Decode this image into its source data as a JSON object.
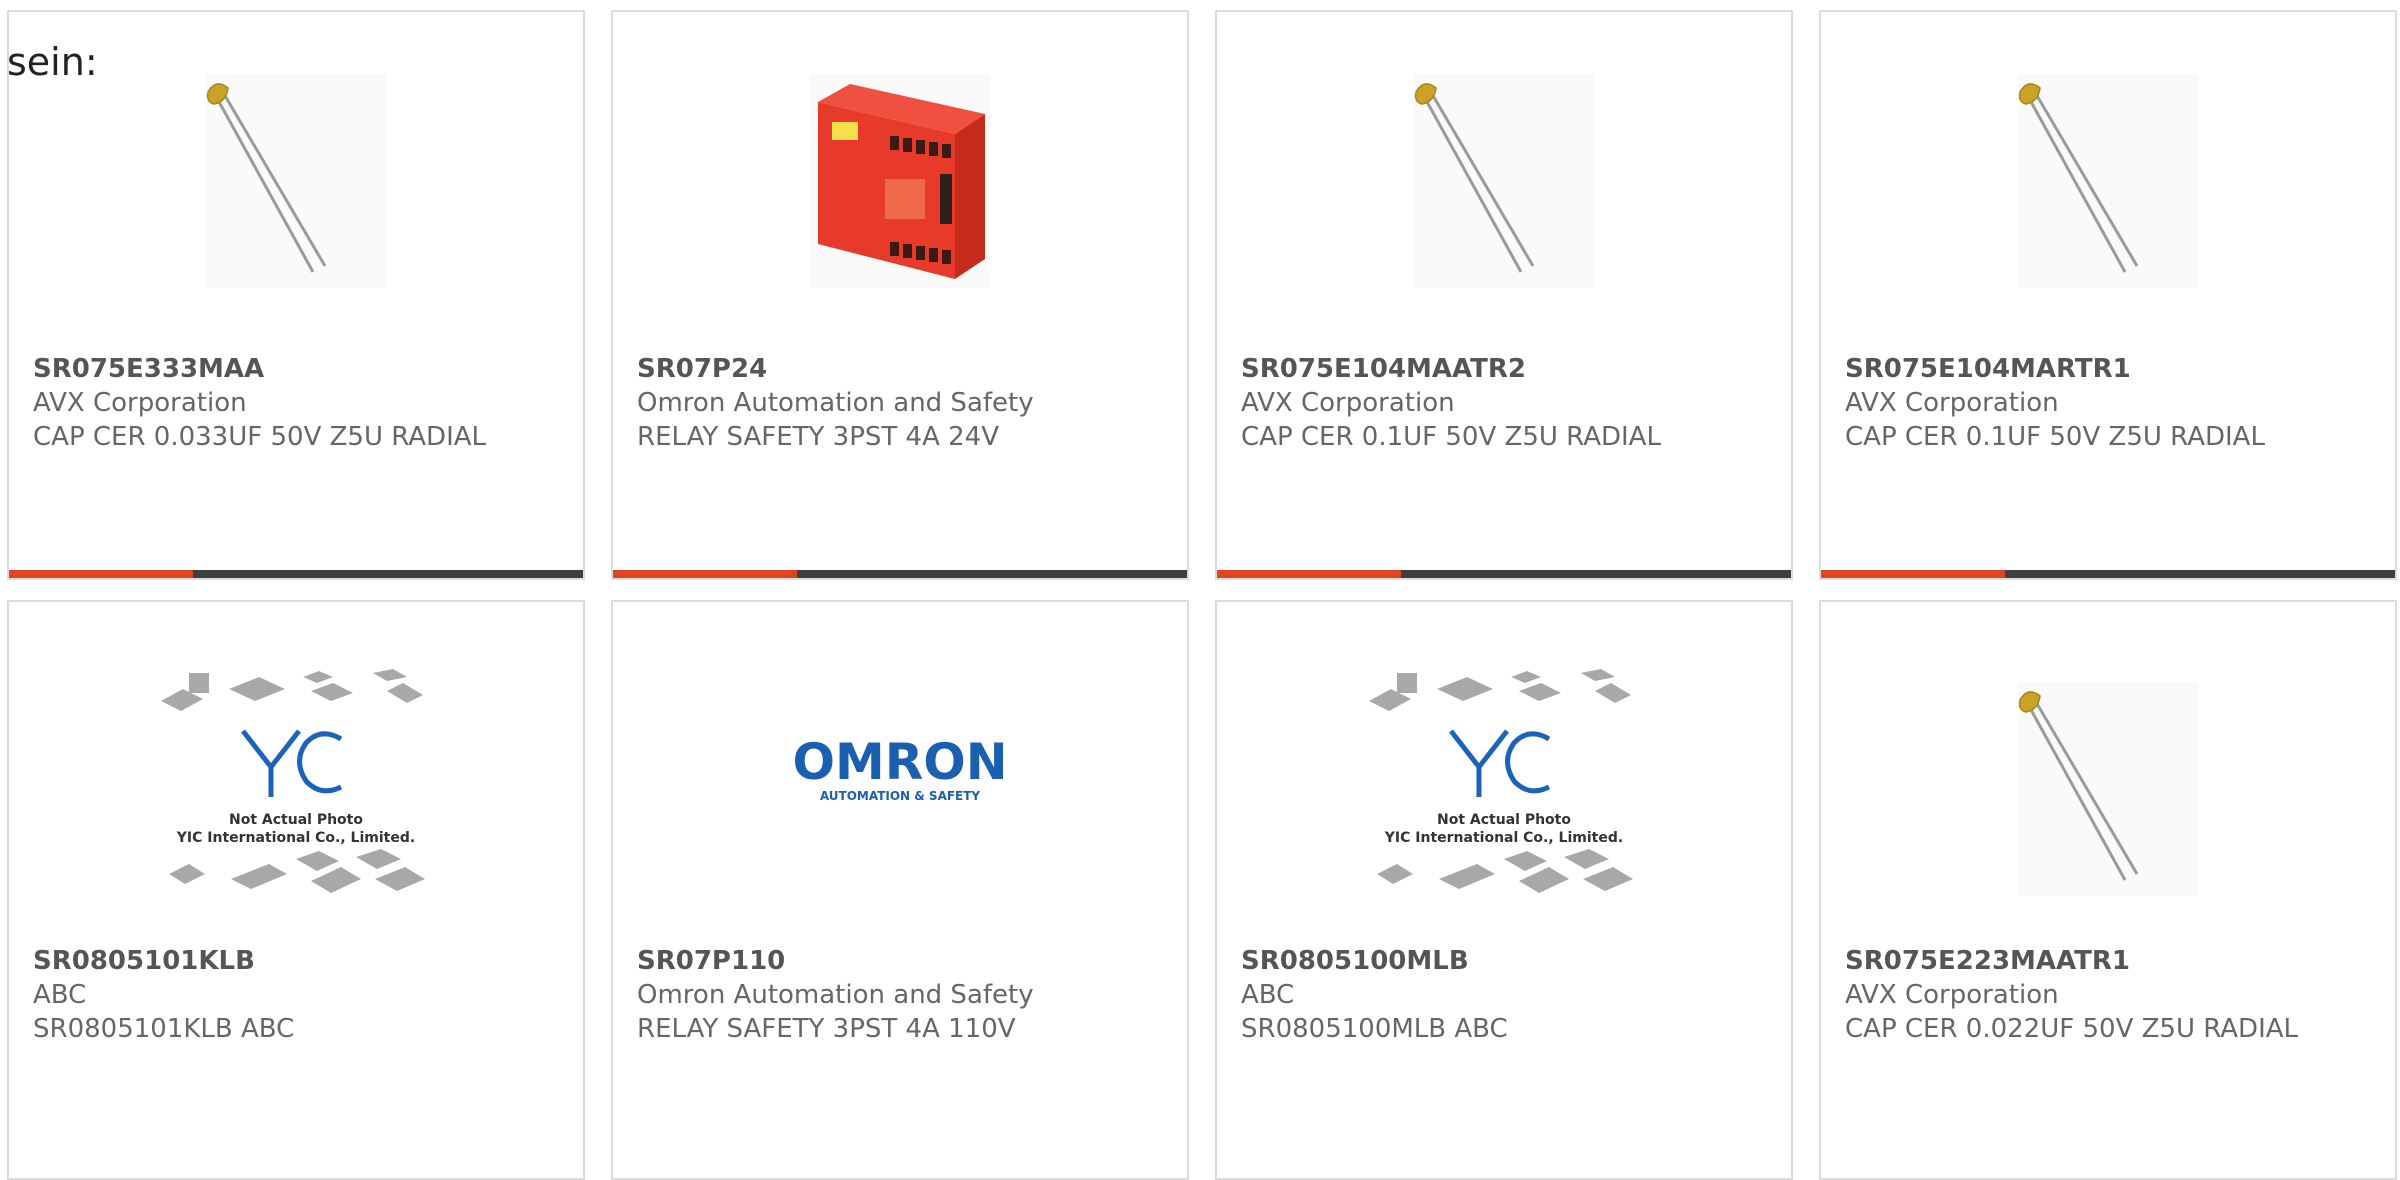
{
  "header": {
    "label": "sein:"
  },
  "colors": {
    "accent": "#e0451f",
    "bar_dark": "#3f3f3f",
    "capacitor_body": "#c9a227",
    "relay_red": "#e83a2a",
    "omron_blue": "#1b5fb0",
    "yic_blue": "#1a63b8"
  },
  "products": [
    {
      "part_number": "SR075E333MAA",
      "manufacturer": "AVX Corporation",
      "description": "CAP CER 0.033UF 50V Z5U RADIAL",
      "image": "capacitor-photo"
    },
    {
      "part_number": "SR07P24",
      "manufacturer": "Omron Automation and Safety",
      "description": "RELAY SAFETY 3PST 4A 24V",
      "image": "relay-photo"
    },
    {
      "part_number": "SR075E104MAATR2",
      "manufacturer": "AVX Corporation",
      "description": "CAP CER 0.1UF 50V Z5U RADIAL",
      "image": "capacitor-photo"
    },
    {
      "part_number": "SR075E104MARTR1",
      "manufacturer": "AVX Corporation",
      "description": "CAP CER 0.1UF 50V Z5U RADIAL",
      "image": "capacitor-photo"
    },
    {
      "part_number": "SR0805101KLB",
      "manufacturer": "ABC",
      "description": "SR0805101KLB ABC",
      "image": "yic-placeholder"
    },
    {
      "part_number": "SR07P110",
      "manufacturer": "Omron Automation and Safety",
      "description": "RELAY SAFETY 3PST 4A 110V",
      "image": "omron-logo"
    },
    {
      "part_number": "SR0805100MLB",
      "manufacturer": "ABC",
      "description": "SR0805100MLB ABC",
      "image": "yic-placeholder"
    },
    {
      "part_number": "SR075E223MAATR1",
      "manufacturer": "AVX Corporation",
      "description": "CAP CER 0.022UF 50V Z5U RADIAL",
      "image": "capacitor-photo"
    }
  ],
  "yic_placeholder": {
    "line1": "Not Actual Photo",
    "line2": "YIC International Co., Limited."
  },
  "omron_logo": {
    "brand": "OMRON",
    "tagline": "AUTOMATION & SAFETY"
  }
}
